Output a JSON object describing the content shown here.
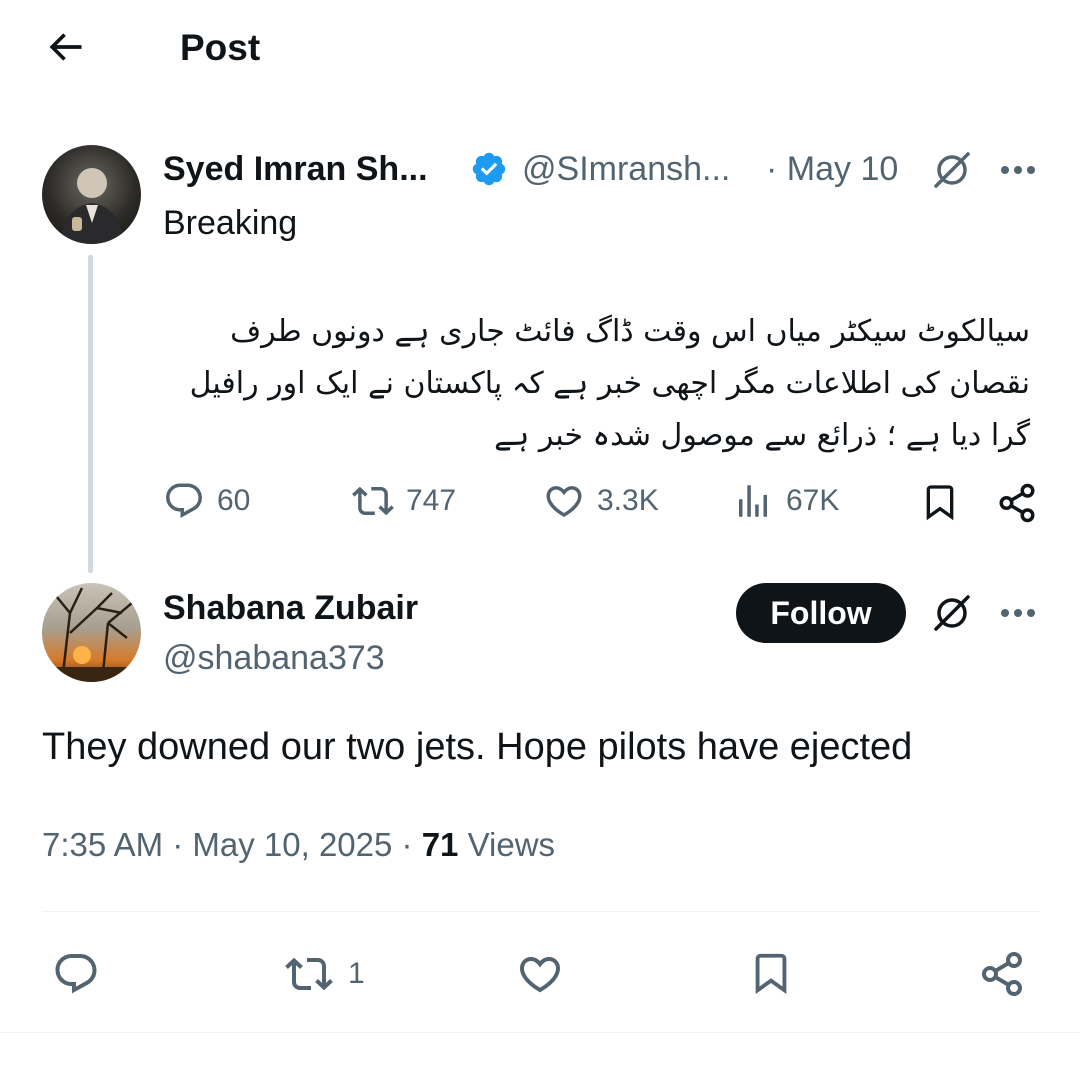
{
  "header": {
    "title": "Post"
  },
  "parent_post": {
    "author_name": "Syed Imran Sh...",
    "handle": "@SImransh...",
    "date": "· May 10",
    "text_line1": "Breaking",
    "urdu_text": "سیالکوٹ سیکٹر میاں اس وقت ڈاگ فائٹ جاری ہے دونوں طرف نقصان کی اطلاعات مگر اچھی خبر ہے کہ پاکستان نے ایک اور رافیل گرا دیا ہے ؛ ذرائع سے موصول شدہ خبر ہے",
    "stats": {
      "replies": "60",
      "reposts": "747",
      "likes": "3.3K",
      "views": "67K"
    },
    "verified_color": "#1d9bf0"
  },
  "reply_post": {
    "author_name": "Shabana Zubair",
    "handle": "@shabana373",
    "follow_label": "Follow",
    "text": "They downed our two jets. Hope pilots have ejected",
    "time": "7:35 AM · May 10, 2025 · ",
    "views_count": "71",
    "views_label": " Views",
    "bottom_stats": {
      "reposts": "1"
    }
  },
  "icons": {
    "back": "arrow-left-icon",
    "verified": "verified-badge-icon",
    "grok": "grok-icon",
    "more": "more-dots-icon",
    "reply": "reply-bubble-icon",
    "repost": "repost-icon",
    "like": "heart-icon",
    "views": "views-bars-icon",
    "bookmark": "bookmark-icon",
    "share": "share-icon"
  },
  "colors": {
    "text_primary": "#0f1419",
    "text_secondary": "#536471",
    "follow_bg": "#0f1419",
    "thread_line": "#cfd9de"
  }
}
